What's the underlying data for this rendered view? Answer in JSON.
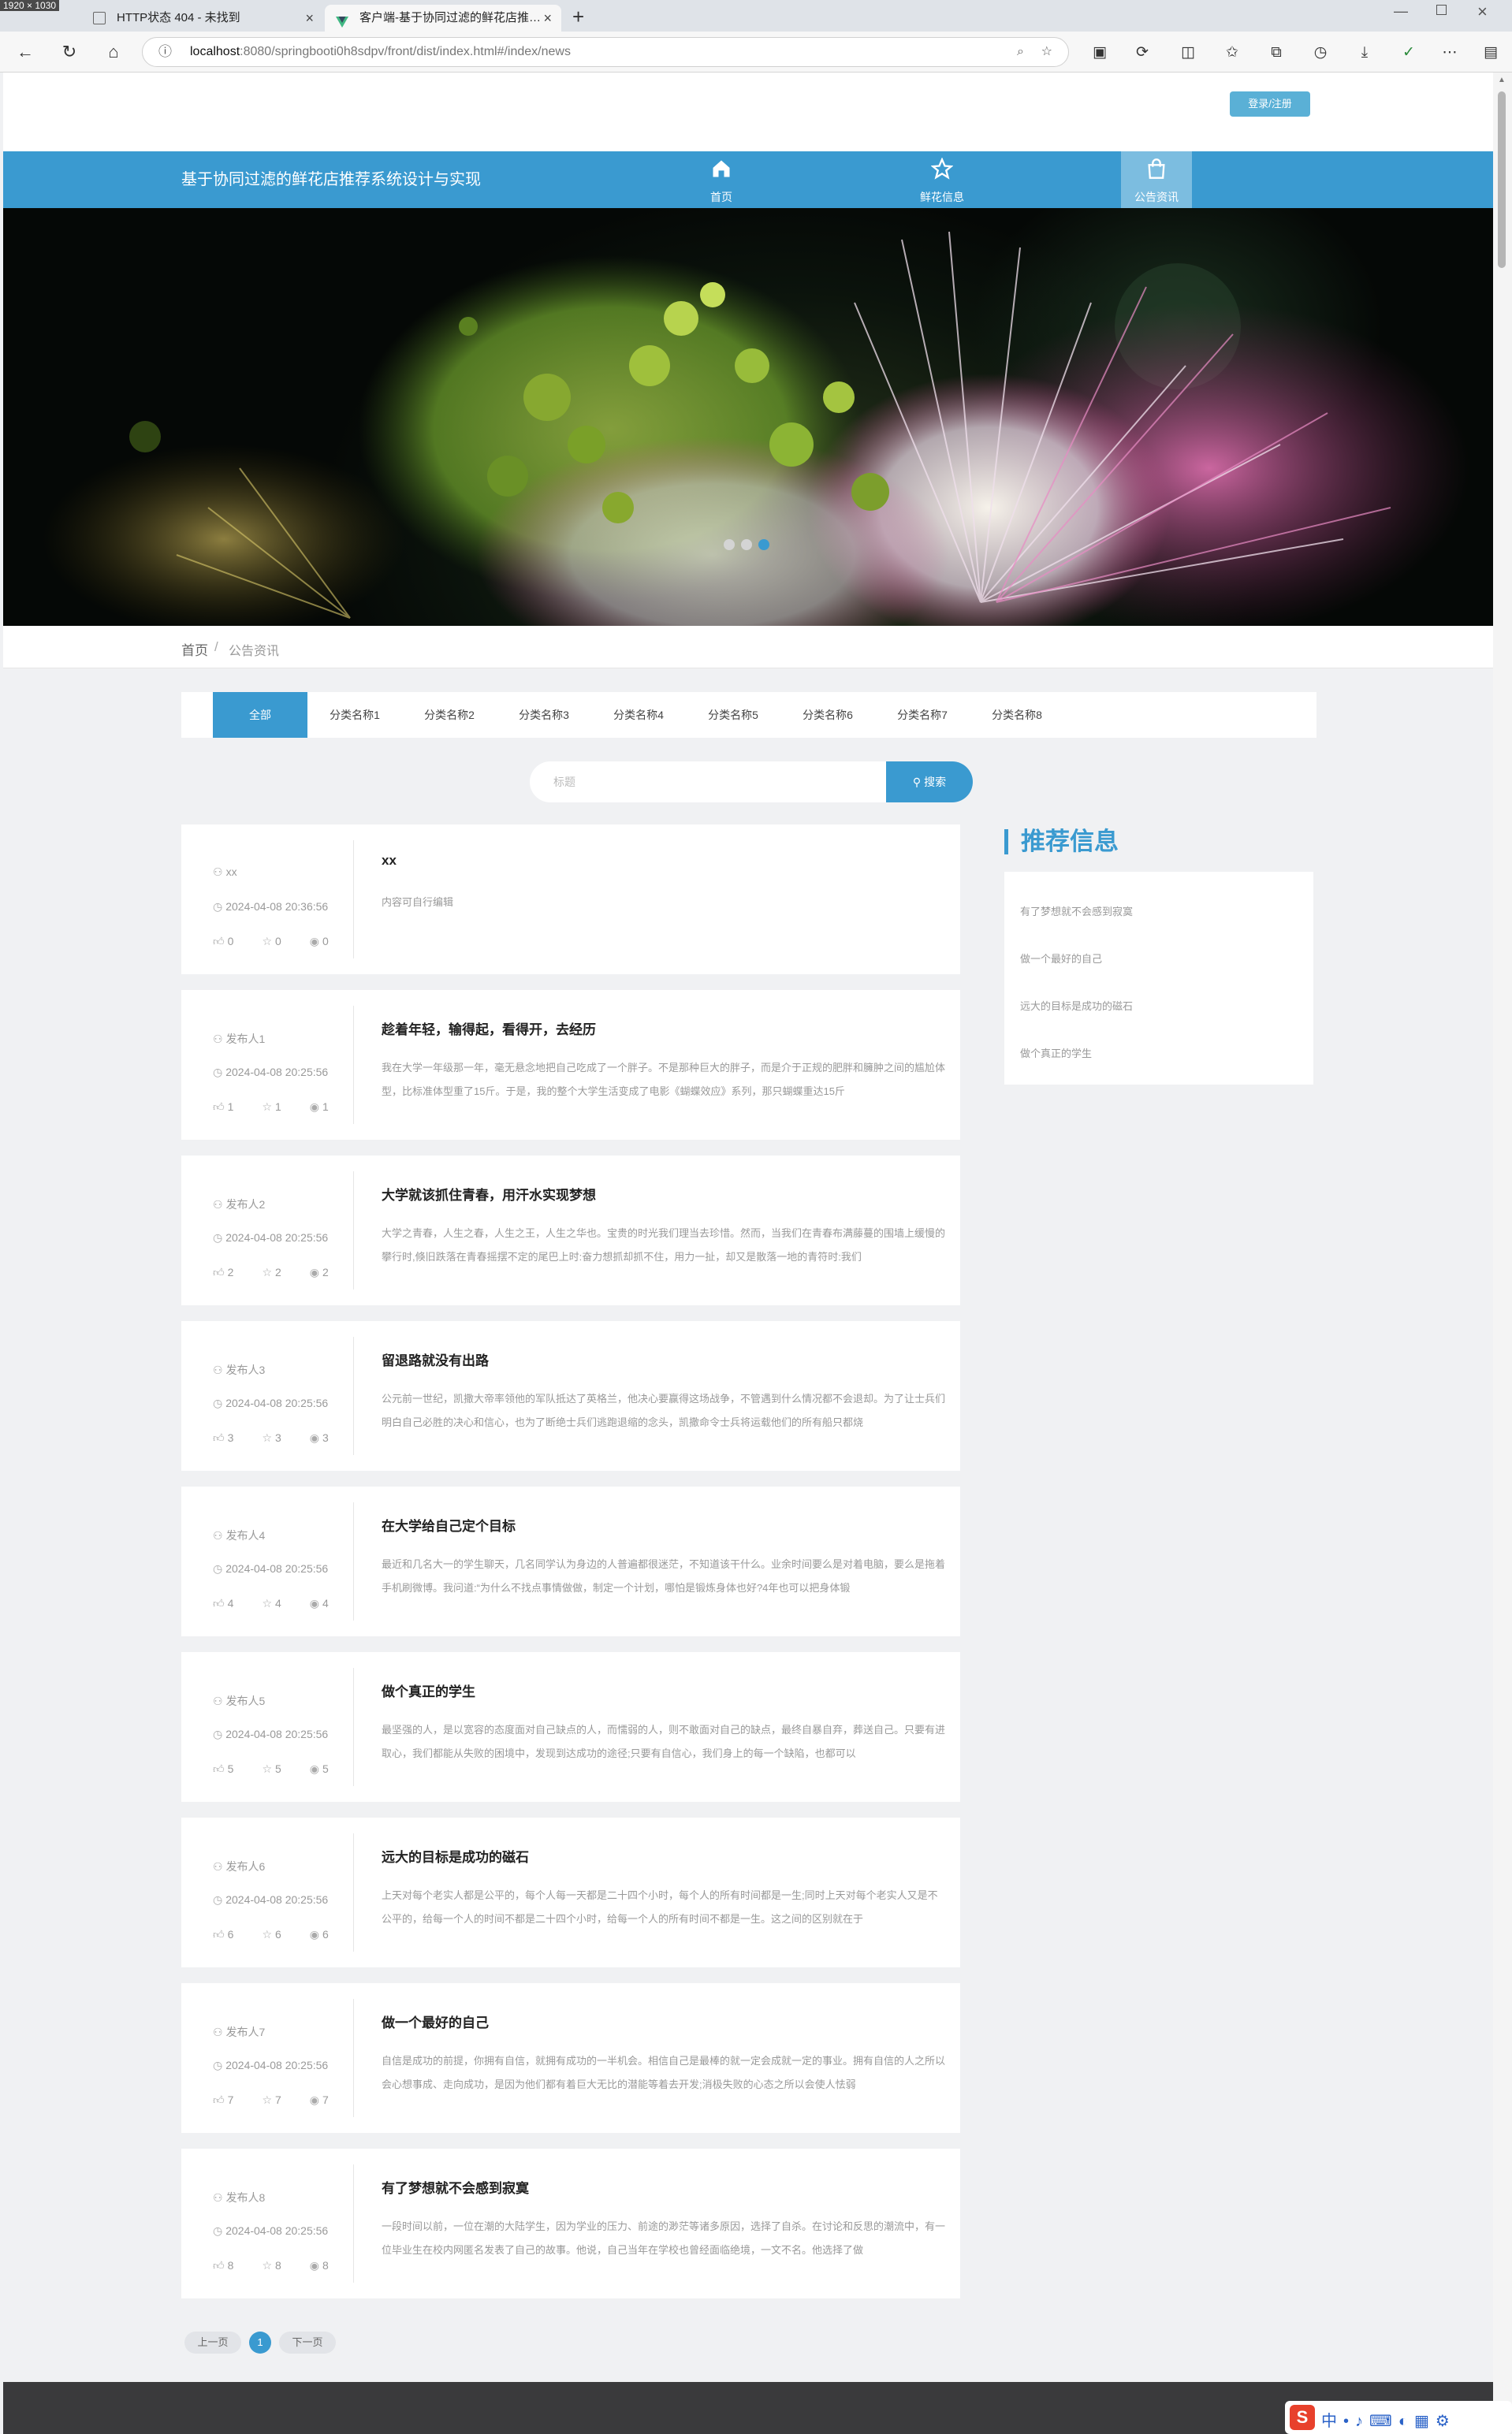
{
  "browser": {
    "size_badge": "1920 × 1030",
    "tabs": [
      {
        "title": "HTTP状态 404 - 未找到",
        "active": false
      },
      {
        "title": "客户端-基于协同过滤的鲜花店推…",
        "active": true
      }
    ],
    "url_host": "localhost",
    "url_rest": ":8080/springbooti0h8sdpv/front/dist/index.html#/index/news"
  },
  "header": {
    "login_label": "登录/注册",
    "site_title": "基于协同过滤的鲜花店推荐系统设计与实现",
    "nav": [
      {
        "label": "首页",
        "icon": "home-icon",
        "active": false
      },
      {
        "label": "鲜花信息",
        "icon": "star-icon",
        "active": false
      },
      {
        "label": "公告资讯",
        "icon": "shopping-bag-icon",
        "active": true
      }
    ]
  },
  "carousel": {
    "dots": 3,
    "active_index": 2
  },
  "breadcrumb": {
    "home": "首页",
    "separator": "/",
    "current": "公告资讯"
  },
  "categories": [
    "全部",
    "分类名称1",
    "分类名称2",
    "分类名称3",
    "分类名称4",
    "分类名称5",
    "分类名称6",
    "分类名称7",
    "分类名称8"
  ],
  "search": {
    "placeholder": "标题",
    "button_label": "搜索"
  },
  "news": [
    {
      "author": "xx",
      "time": "2024-04-08 20:36:56",
      "likes": "0",
      "favs": "0",
      "views": "0",
      "title": "xx",
      "body": "内容可自行编辑"
    },
    {
      "author": "发布人1",
      "time": "2024-04-08 20:25:56",
      "likes": "1",
      "favs": "1",
      "views": "1",
      "title": "趁着年轻，输得起，看得开，去经历",
      "body": "我在大学一年级那一年，毫无悬念地把自己吃成了一个胖子。不是那种巨大的胖子，而是介于正规的肥胖和臃肿之间的尴尬体型，比标准体型重了15斤。于是，我的整个大学生活变成了电影《蝴蝶效应》系列，那只蝴蝶重达15斤"
    },
    {
      "author": "发布人2",
      "time": "2024-04-08 20:25:56",
      "likes": "2",
      "favs": "2",
      "views": "2",
      "title": "大学就该抓住青春，用汗水实现梦想",
      "body": "大学之青春，人生之春，人生之王，人生之华也。宝贵的时光我们理当去珍惜。然而，当我们在青春布满藤蔓的围墙上缓慢的攀行时,倏旧跌落在青春摇摆不定的尾巴上时:奋力想抓却抓不住，用力一扯，却又是散落一地的青符时:我们"
    },
    {
      "author": "发布人3",
      "time": "2024-04-08 20:25:56",
      "likes": "3",
      "favs": "3",
      "views": "3",
      "title": "留退路就没有出路",
      "body": "公元前一世纪，凯撒大帝率领他的军队抵达了英格兰，他决心要赢得这场战争，不管遇到什么情况都不会退却。为了让士兵们明白自己必胜的决心和信心，也为了断绝士兵们逃跑退缩的念头，凯撒命令士兵将运载他们的所有船只都烧"
    },
    {
      "author": "发布人4",
      "time": "2024-04-08 20:25:56",
      "likes": "4",
      "favs": "4",
      "views": "4",
      "title": "在大学给自己定个目标",
      "body": "最近和几名大一的学生聊天，几名同学认为身边的人普遍都很迷茫，不知道该干什么。业余时间要么是对着电脑，要么是拖着手机刷微博。我问道:“为什么不找点事情做做，制定一个计划，哪怕是锻炼身体也好?4年也可以把身体锻"
    },
    {
      "author": "发布人5",
      "time": "2024-04-08 20:25:56",
      "likes": "5",
      "favs": "5",
      "views": "5",
      "title": "做个真正的学生",
      "body": "最坚强的人，是以宽容的态度面对自己缺点的人，而懦弱的人，则不敢面对自己的缺点，最终自暴自弃，葬送自己。只要有进取心，我们都能从失败的困境中，发现到达成功的途径;只要有自信心，我们身上的每一个缺陷，也都可以"
    },
    {
      "author": "发布人6",
      "time": "2024-04-08 20:25:56",
      "likes": "6",
      "favs": "6",
      "views": "6",
      "title": "远大的目标是成功的磁石",
      "body": "上天对每个老实人都是公平的，每个人每一天都是二十四个小时，每个人的所有时间都是一生;同时上天对每个老实人又是不公平的，给每一个人的时间不都是二十四个小时，给每一个人的所有时间不都是一生。这之间的区别就在于"
    },
    {
      "author": "发布人7",
      "time": "2024-04-08 20:25:56",
      "likes": "7",
      "favs": "7",
      "views": "7",
      "title": "做一个最好的自己",
      "body": "自信是成功的前提，你拥有自信，就拥有成功的一半机会。相信自己是最棒的就一定会成就一定的事业。拥有自信的人之所以会心想事成、走向成功，是因为他们都有着巨大无比的潜能等着去开发;消极失败的心态之所以会使人怯弱"
    },
    {
      "author": "发布人8",
      "time": "2024-04-08 20:25:56",
      "likes": "8",
      "favs": "8",
      "views": "8",
      "title": "有了梦想就不会感到寂寞",
      "body": "一段时间以前，一位在潮的大陆学生，因为学业的压力、前途的渺茫等诸多原因，选择了自杀。在讨论和反思的潮流中，有一位毕业生在校内网匿名发表了自己的故事。他说，自己当年在学校也曾经面临绝境，一文不名。他选择了做"
    }
  ],
  "recommend": {
    "title": "推荐信息",
    "items": [
      "有了梦想就不会感到寂寞",
      "做一个最好的自己",
      "远大的目标是成功的磁石",
      "做个真正的学生"
    ]
  },
  "pagination": {
    "prev": "上一页",
    "current": "1",
    "next": "下一页"
  },
  "colors": {
    "primary": "#3a9ad0",
    "nav_active": "#7cbde0",
    "footer": "#3a3a3c",
    "login": "#5ab0d6"
  }
}
